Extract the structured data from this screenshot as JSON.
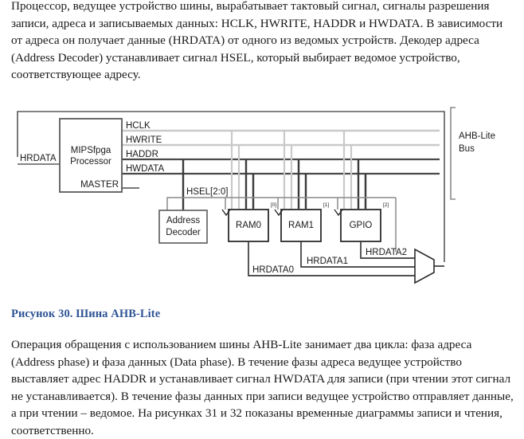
{
  "document": {
    "paragraph_top": "Процессор, ведущее устройство шины, вырабатывает тактовый сигнал, сигналы разрешения записи, адреса и записываемых данных: HCLK, HWRITE, HADDR и HWDATA. В зависимости от адреса он получает данные (HRDATA) от одного из ведомых устройств. Декодер адреса (Address Decoder) устанавливает сигнал HSEL, который выбирает ведомое устройство, соответствующее адресу.",
    "figure_caption": "Рисунок 30. Шина AHB-Lite",
    "paragraph_bottom": "Операция обращения с использованием шины AHB-Lite занимает два цикла: фаза адреса (Address phase) и фаза данных (Data phase). В течение фазы адреса ведущее устройство выставляет адрес HADDR и устанавливает сигнал HWDATA для записи  (при чтении этот сигнал не устанавливается). В течение фазы данных при записи ведущее устройство отправляет данные, а при чтении – ведомое. На рисунках 31 и  32 показаны временные диаграммы записи и чтения, соответственно.",
    "caption_color": "#2f5496",
    "text_color": "#1a1a1a"
  },
  "diagram": {
    "title": "AHB-Lite bus block diagram",
    "master": {
      "line1": "MIPSfpga",
      "line2": "Processor",
      "role_label": "MASTER"
    },
    "bus_signals": [
      {
        "name": "HCLK",
        "style": "light"
      },
      {
        "name": "HWRITE",
        "style": "light"
      },
      {
        "name": "HADDR",
        "style": "dark"
      },
      {
        "name": "HWDATA",
        "style": "dark"
      }
    ],
    "feedback_signal": "HRDATA",
    "select_signal": "HSEL[2:0]",
    "decoder": {
      "line1": "Address",
      "line2": "Decoder"
    },
    "slaves": [
      {
        "label": "RAM0",
        "index": "[0]",
        "read_data": "HRDATA0"
      },
      {
        "label": "RAM1",
        "index": "[1]",
        "read_data": "HRDATA1"
      },
      {
        "label": "GPIO",
        "index": "[2]",
        "read_data": "HRDATA2"
      }
    ],
    "bus_bracket": {
      "line1": "AHB-Lite",
      "line2": "Bus"
    },
    "mux_name": "read-data-multiplexer",
    "colors": {
      "line_dark": "#3a3a3a",
      "line_light": "#c9c9c9",
      "line_black": "#2b2b2b",
      "box_border": "#5a5a5a",
      "bracket": "#8a8a8a"
    }
  }
}
